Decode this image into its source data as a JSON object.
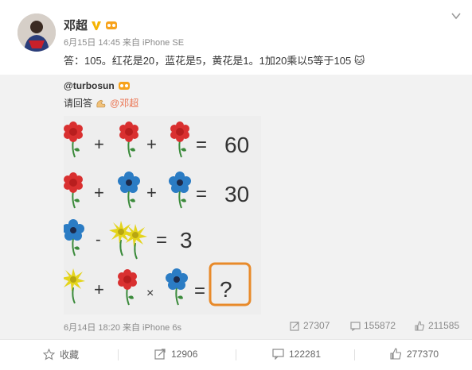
{
  "post": {
    "author": "邓超",
    "meta": "6月15日 14:45 来自 iPhone SE",
    "content": "答：105。红花是20，蓝花是5，黄花是1。1加20乘以5等于105",
    "content_emoji": "🐱"
  },
  "repost": {
    "handle": "@turbosun",
    "text": "请回答",
    "mention": "@邓超",
    "meta": "6月14日 18:20 来自 iPhone 6s",
    "stats": {
      "forward": "27307",
      "comment": "155872",
      "like": "211585"
    },
    "puzzle": {
      "row1_result": "60",
      "row2_result": "30",
      "row3_result": "3",
      "row4_result": "?",
      "plus": "+",
      "minus": "-",
      "times": "×",
      "equals": "="
    }
  },
  "actions": {
    "favorite": "收藏",
    "forward": "12906",
    "comment": "122281",
    "like": "277370"
  },
  "colors": {
    "accent": "#eb7350",
    "badge_v": "#f5b301",
    "red_flower": "#d93030",
    "blue_flower": "#2b7cc4",
    "yellow_flower": "#e4d41c"
  }
}
